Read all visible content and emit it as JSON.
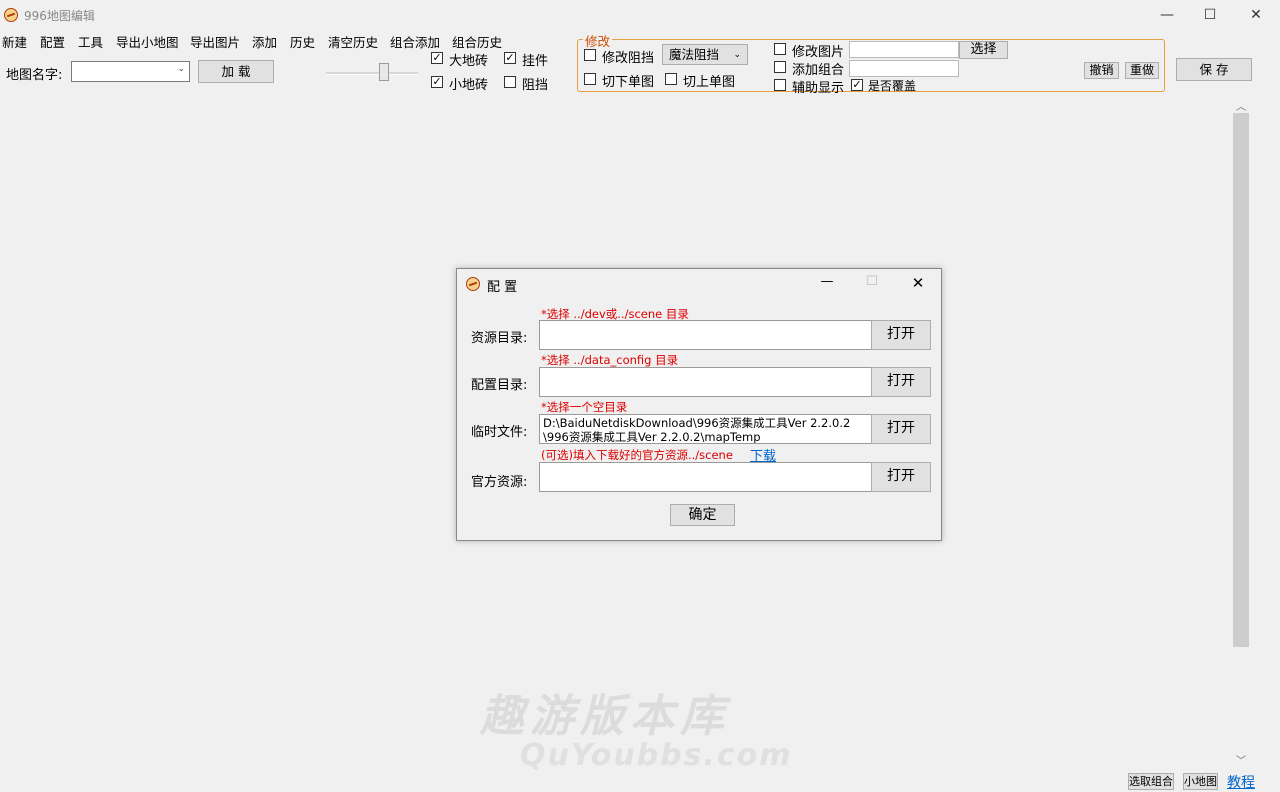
{
  "window": {
    "title": "996地图编辑",
    "min": "—",
    "max": "☐",
    "close": "✕"
  },
  "menu": [
    "新建",
    "配置",
    "工具",
    "导出小地图",
    "导出图片",
    "添加",
    "历史",
    "清空历史",
    "组合添加",
    "组合历史"
  ],
  "toolbar": {
    "map_name_label": "地图名字:",
    "map_name_value": "",
    "load_button": "加 载",
    "check_big_tile": {
      "label": "大地砖",
      "checked": true
    },
    "check_pendant": {
      "label": "挂件",
      "checked": true
    },
    "check_small_tile": {
      "label": "小地砖",
      "checked": true
    },
    "check_block": {
      "label": "阻挡",
      "checked": false
    }
  },
  "modify_group": {
    "legend": "修改",
    "modify_block": {
      "label": "修改阻挡",
      "checked": false
    },
    "block_type_select": "魔法阻挡",
    "cut_down": {
      "label": "切下单图",
      "checked": false
    },
    "cut_up": {
      "label": "切上单图",
      "checked": false
    },
    "modify_image": {
      "label": "修改图片",
      "checked": false
    },
    "add_combo": {
      "label": "添加组合",
      "checked": false
    },
    "aux_display": {
      "label": "辅助显示",
      "checked": false
    },
    "overwrite": {
      "label": "是否覆盖",
      "checked": true
    },
    "select_button": "选择",
    "undo_button": "撤销",
    "redo_button": "重做"
  },
  "save_button": "保 存",
  "dialog": {
    "title": "配 置",
    "min": "—",
    "max": "☐",
    "close": "✕",
    "hint_resource": "*选择 ../dev或../scene 目录",
    "resource_label": "资源目录:",
    "resource_value": "",
    "hint_config": "*选择 ../data_config 目录",
    "config_label": "配置目录:",
    "config_value": "",
    "hint_temp": "*选择一个空目录",
    "temp_label": "临时文件:",
    "temp_value_line1": "D:\\BaiduNetdiskDownload\\996资源集成工具Ver 2.2.0.2",
    "temp_value_line2": "\\996资源集成工具Ver 2.2.0.2\\mapTemp",
    "hint_official": "(可选)填入下载好的官方资源../scene",
    "download_link": "下载",
    "official_label": "官方资源:",
    "official_value": "",
    "open_button": "打开",
    "ok_button": "确定"
  },
  "bottom": {
    "select_combo": "选取组合",
    "minimap": "小地图",
    "tutorial": "教程"
  },
  "watermark": {
    "line1": "趣游版本库",
    "line2": "QuYoubbs.com"
  },
  "colors": {
    "group_border": "#e8a03c",
    "legend": "#d04a00",
    "hint_red": "#dd0000",
    "link_blue": "#0066cc"
  }
}
